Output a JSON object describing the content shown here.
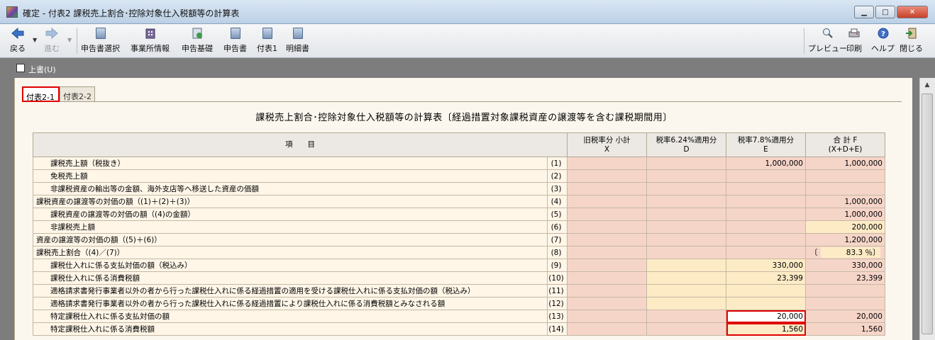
{
  "window": {
    "title": "確定 - 付表2 課税売上割合･控除対象仕入税額等の計算表"
  },
  "toolbar": {
    "back_label": "戻る",
    "forward_label": "進む",
    "buttons": [
      {
        "label": "申告書選択",
        "icon": "document-select-icon"
      },
      {
        "label": "事業所情報",
        "icon": "office-info-icon"
      },
      {
        "label": "申告基礎",
        "icon": "info-icon"
      },
      {
        "label": "申告書",
        "icon": "document-icon"
      },
      {
        "label": "付表1",
        "icon": "document-icon"
      },
      {
        "label": "明細書",
        "icon": "document-icon"
      }
    ],
    "right_buttons": [
      {
        "label": "プレビュー",
        "icon": "magnifier-icon"
      },
      {
        "label": "印刷",
        "icon": "printer-icon"
      },
      {
        "label": "ヘルプ",
        "icon": "help-icon"
      },
      {
        "label": "閉じる",
        "icon": "exit-icon"
      }
    ]
  },
  "options": {
    "overwrite_label": "上書(U)"
  },
  "tabs": [
    {
      "label": "付表2-1",
      "active": true
    },
    {
      "label": "付表2-2",
      "active": false
    }
  ],
  "form": {
    "title": "課税売上割合･控除対象仕入税額等の計算表〔経過措置対象課税資産の譲渡等を含む課税期間用〕",
    "headers": {
      "item": "項　　目",
      "x_line1": "旧税率分 小計",
      "x_line2": "X",
      "d_line1": "税率6.24%適用分",
      "d_line2": "D",
      "e_line1": "税率7.8%適用分",
      "e_line2": "E",
      "f_line1": "合 計 F",
      "f_line2": "(X+D+E)"
    },
    "rows": [
      {
        "label": "課税売上額（税抜き）",
        "num": "(1)",
        "x": "",
        "d": "",
        "e": "1,000,000",
        "f": "1,000,000"
      },
      {
        "label": "免税売上額",
        "num": "(2)",
        "x": "",
        "d": "",
        "e": "",
        "f": ""
      },
      {
        "label": "非課税資産の輸出等の金額、海外支店等へ移送した資産の価額",
        "num": "(3)",
        "x": "",
        "d": "",
        "e": "",
        "f": ""
      },
      {
        "label": "課税資産の譲渡等の対価の額（(1)＋(2)＋(3)）",
        "num": "(4)",
        "x": "",
        "d": "",
        "e": "",
        "f": "1,000,000"
      },
      {
        "label": "課税資産の譲渡等の対価の額（(4)の金額）",
        "num": "(5)",
        "x": "",
        "d": "",
        "e": "",
        "f": "1,000,000"
      },
      {
        "label": "非課税売上額",
        "num": "(6)",
        "x": "",
        "d": "",
        "e": "",
        "f": "200,000"
      },
      {
        "label": "資産の譲渡等の対価の額（(5)＋(6)）",
        "num": "(7)",
        "x": "",
        "d": "",
        "e": "",
        "f": "1,200,000"
      },
      {
        "label": "課税売上割合（(4)／(7)）",
        "num": "(8)",
        "x": "",
        "d": "",
        "e": "",
        "f_open": "〔",
        "f": "83.3 ％〕"
      },
      {
        "label": "課税仕入れに係る支払対価の額（税込み）",
        "num": "(9)",
        "x": "",
        "d": "",
        "e": "330,000",
        "f": "330,000"
      },
      {
        "label": "課税仕入れに係る消費税額",
        "num": "(10)",
        "x": "",
        "d": "",
        "e": "23,399",
        "f": "23,399"
      },
      {
        "label": "適格請求書発行事業者以外の者から行った課税仕入れに係る経過措置の適用を受ける課税仕入れに係る支払対価の額（税込み）",
        "num": "(11)",
        "x": "",
        "d": "",
        "e": "",
        "f": ""
      },
      {
        "label": "適格請求書発行事業者以外の者から行った課税仕入れに係る経過措置により課税仕入れに係る消費税額とみなされる額",
        "num": "(12)",
        "x": "",
        "d": "",
        "e": "",
        "f": ""
      },
      {
        "label": "特定課税仕入れに係る支払対価の額",
        "num": "(13)",
        "x": "",
        "d": "",
        "e": "20,000",
        "f": "20,000"
      },
      {
        "label": "特定課税仕入れに係る消費税額",
        "num": "(14)",
        "x": "",
        "d": "",
        "e": "1,560",
        "f": "1,560"
      }
    ]
  },
  "colors": {
    "highlight": "#e00000",
    "pink_cell": "#f6d5c9",
    "cream_cell": "#fdebc6"
  }
}
